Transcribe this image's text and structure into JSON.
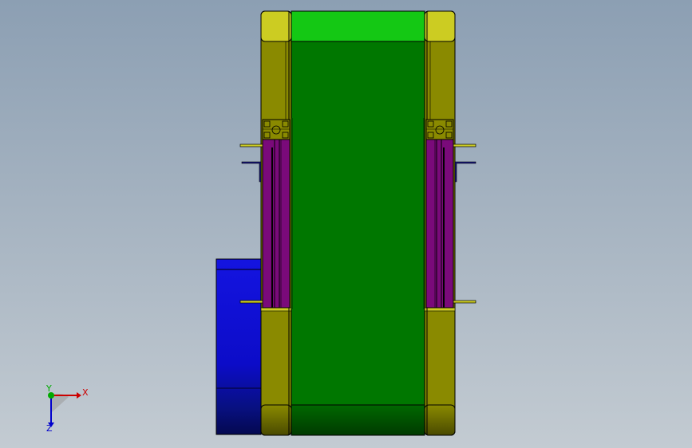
{
  "viewport": {
    "background_top": "#8c9fb3",
    "background_bottom": "#c3cbd2"
  },
  "model": {
    "colors": {
      "roller": "#007700",
      "roller_top": "#14c814",
      "side_frame": "#8a8a00",
      "side_cap": "#cccc22",
      "guide_plate": "#7a0a7a",
      "motor": "#1010d0",
      "outline": "#000000",
      "bracket": "#15157a"
    }
  },
  "triad": {
    "x_label": "X",
    "y_label": "Y",
    "z_label": "Z",
    "x_color": "#cc0000",
    "y_color": "#00aa00",
    "z_color": "#0000cc"
  }
}
